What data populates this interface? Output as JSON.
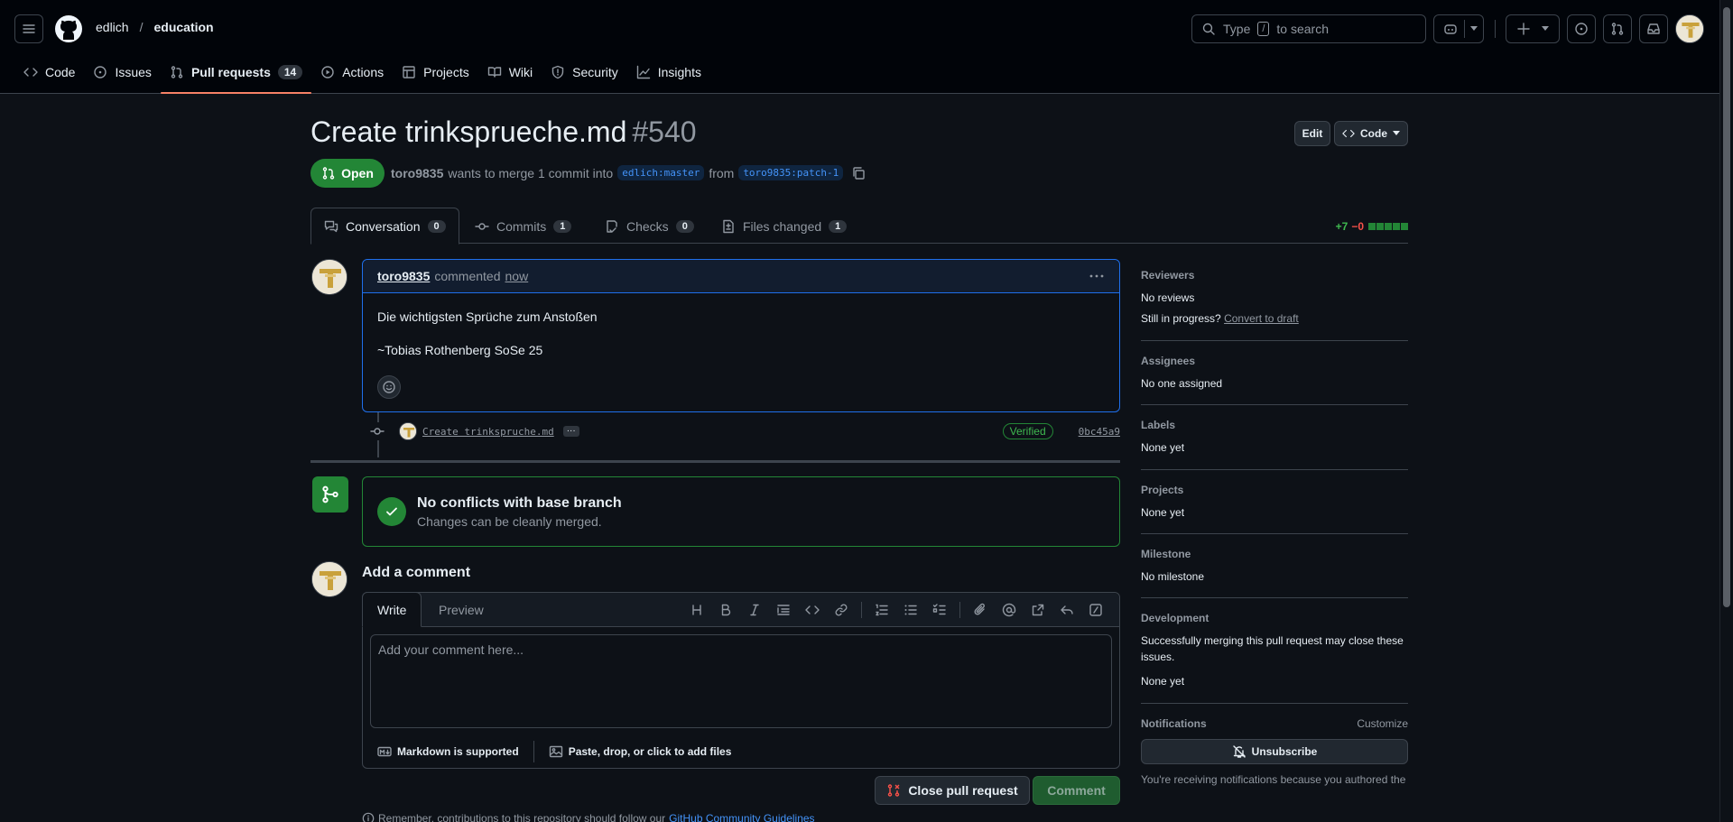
{
  "header": {
    "owner": "edlich",
    "separator": "/",
    "repo": "education",
    "search": {
      "prefix": "Type",
      "key": "/",
      "suffix": "to search"
    }
  },
  "repo_nav": [
    {
      "label": "Code",
      "icon": "code-icon"
    },
    {
      "label": "Issues",
      "icon": "issue-icon"
    },
    {
      "label": "Pull requests",
      "icon": "pull-request-icon",
      "count": "14",
      "active": true
    },
    {
      "label": "Actions",
      "icon": "play-icon"
    },
    {
      "label": "Projects",
      "icon": "table-icon"
    },
    {
      "label": "Wiki",
      "icon": "book-icon"
    },
    {
      "label": "Security",
      "icon": "shield-icon"
    },
    {
      "label": "Insights",
      "icon": "graph-icon"
    }
  ],
  "pr": {
    "title": "Create trinksprueche.md",
    "number": "#540",
    "state": "Open",
    "author": "toro9835",
    "meta_text": "wants to merge 1 commit into",
    "base_branch": "edlich:master",
    "from": "from",
    "head_branch": "toro9835:patch-1",
    "edit_label": "Edit",
    "code_label": "Code"
  },
  "tabs": [
    {
      "label": "Conversation",
      "count": "0",
      "active": true
    },
    {
      "label": "Commits",
      "count": "1"
    },
    {
      "label": "Checks",
      "count": "0"
    },
    {
      "label": "Files changed",
      "count": "1"
    }
  ],
  "diffstat": {
    "additions": "+7",
    "deletions": "−0",
    "blocks": 5
  },
  "comment": {
    "author": "toro9835",
    "action": "commented",
    "time": "now",
    "lines": [
      "Die wichtigsten Sprüche zum Anstoßen",
      "~Tobias Rothenberg SoSe 25"
    ]
  },
  "commit": {
    "message": "Create trinkspruche.md",
    "ellipsis": "···",
    "verified": "Verified",
    "sha": "0bc45a9"
  },
  "merge": {
    "title": "No conflicts with base branch",
    "subtitle": "Changes can be cleanly merged."
  },
  "add_comment": {
    "title": "Add a comment",
    "write_tab": "Write",
    "preview_tab": "Preview",
    "placeholder": "Add your comment here...",
    "markdown_label": "Markdown is supported",
    "attach_label": "Paste, drop, or click to add files",
    "close_button": "Close pull request",
    "comment_button": "Comment",
    "footnote_text": "Remember, contributions to this repository should follow our",
    "footnote_link": "GitHub Community Guidelines"
  },
  "sidebar": {
    "reviewers": {
      "heading": "Reviewers",
      "value": "No reviews",
      "progress_text": "Still in progress?",
      "draft_link": "Convert to draft"
    },
    "assignees": {
      "heading": "Assignees",
      "value": "No one assigned"
    },
    "labels": {
      "heading": "Labels",
      "value": "None yet"
    },
    "projects": {
      "heading": "Projects",
      "value": "None yet"
    },
    "milestone": {
      "heading": "Milestone",
      "value": "No milestone"
    },
    "development": {
      "heading": "Development",
      "text": "Successfully merging this pull request may close these issues.",
      "value": "None yet"
    },
    "notifications": {
      "heading": "Notifications",
      "customize": "Customize",
      "button": "Unsubscribe",
      "tail": "You're receiving notifications because you authored the thread."
    }
  },
  "colors": {
    "accent": "#238636",
    "link": "#4493f8",
    "tab_underline": "#f78166",
    "background": "#0d1117"
  }
}
